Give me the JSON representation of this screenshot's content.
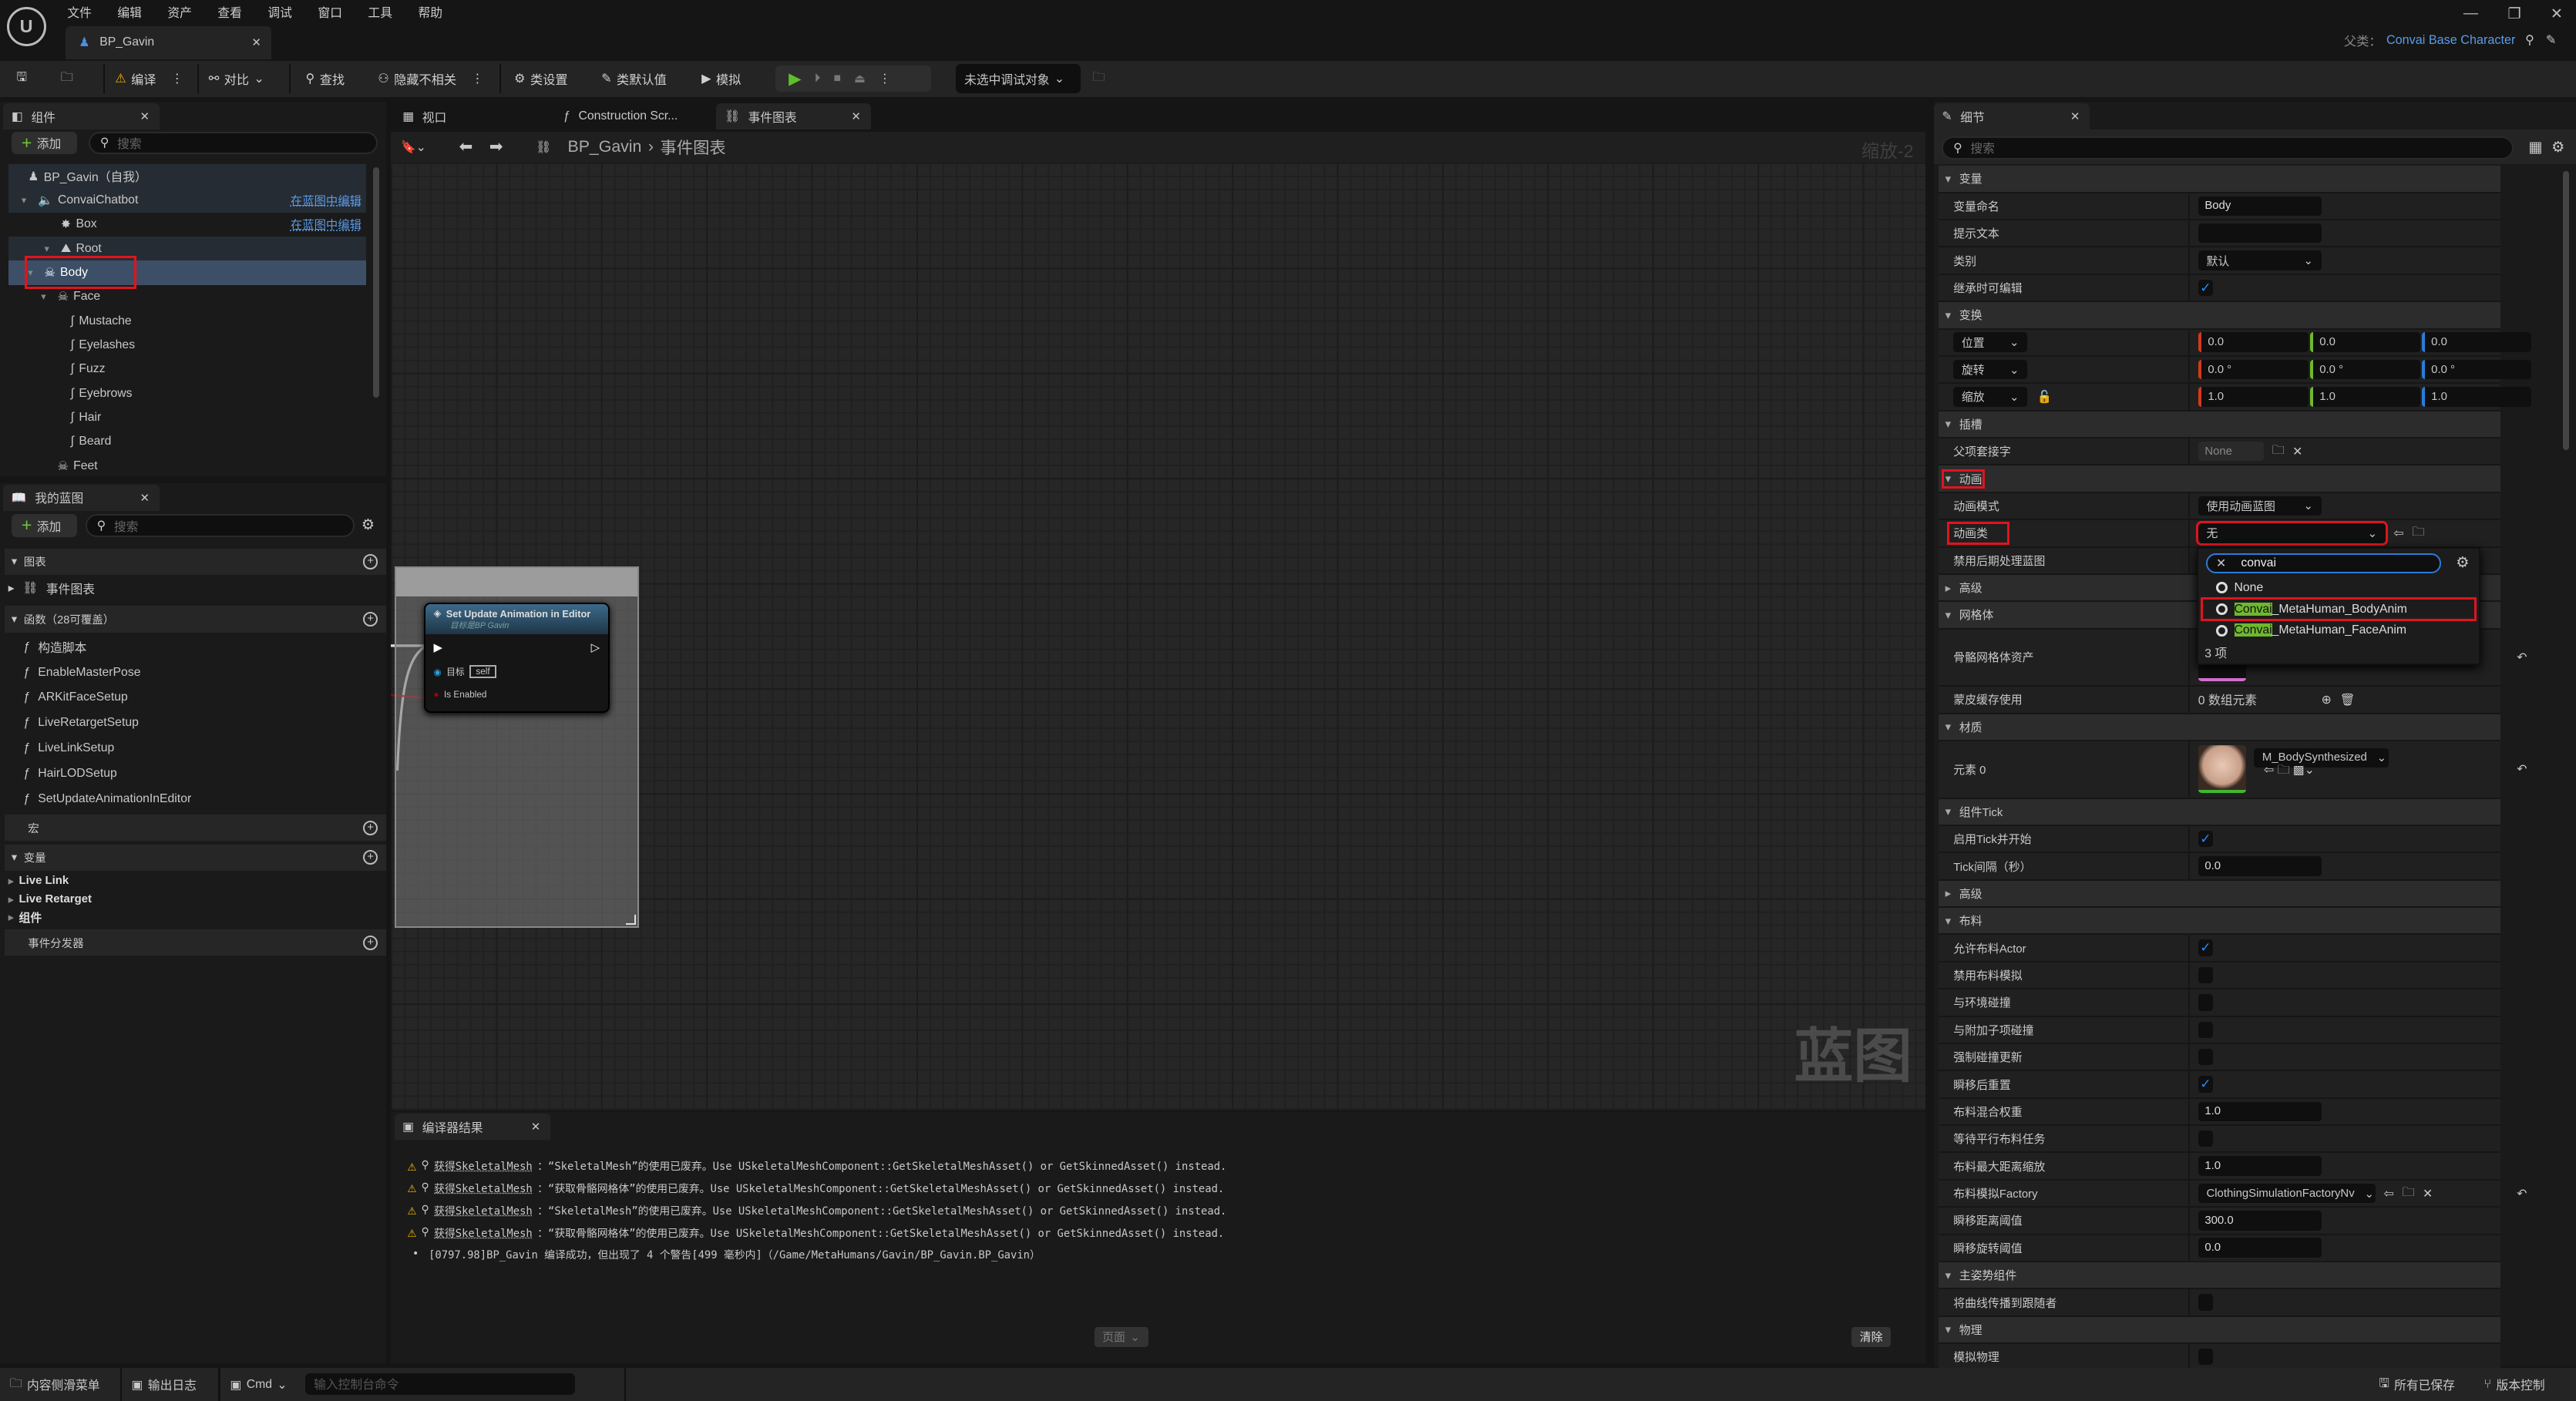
{
  "app": {
    "menu": [
      "文件",
      "编辑",
      "资产",
      "查看",
      "调试",
      "窗口",
      "工具",
      "帮助"
    ],
    "doc_tab": "BP_Gavin",
    "parent_class_label": "父类：",
    "parent_class": "Convai Base Character"
  },
  "toolbar": {
    "compile": "编译",
    "diff": "对比",
    "find": "查找",
    "hide_unrelated": "隐藏不相关",
    "class_settings": "类设置",
    "class_defaults": "类默认值",
    "simulate": "模拟",
    "debug_object": "未选中调试对象"
  },
  "components": {
    "tab": "组件",
    "add": "添加",
    "search_placeholder": "搜索",
    "edit_in_blueprint": "在蓝图中编辑",
    "tree": [
      {
        "label": "BP_Gavin（自我）",
        "icon": "pawn-icon",
        "indent": 0,
        "arrow": false,
        "style": "hl"
      },
      {
        "label": "ConvaiChatbot",
        "icon": "speaker-icon",
        "indent": 1,
        "arrow": true,
        "style": "hl",
        "link": true
      },
      {
        "label": "Box",
        "icon": "collision-icon",
        "indent": 2,
        "arrow": false,
        "style": "",
        "link": true
      },
      {
        "label": "Root",
        "icon": "scene-icon",
        "indent": 2,
        "arrow": true,
        "style": "hl"
      },
      {
        "label": "Body",
        "icon": "skeleton-icon",
        "indent": 3,
        "arrow": true,
        "style": "sel",
        "highlighted": true
      },
      {
        "label": "Face",
        "icon": "skeleton-icon",
        "indent": 4,
        "arrow": true,
        "style": ""
      },
      {
        "label": "Mustache",
        "icon": "groom-icon",
        "indent": 5,
        "arrow": false,
        "style": ""
      },
      {
        "label": "Eyelashes",
        "icon": "groom-icon",
        "indent": 5,
        "arrow": false,
        "style": ""
      },
      {
        "label": "Fuzz",
        "icon": "groom-icon",
        "indent": 5,
        "arrow": false,
        "style": ""
      },
      {
        "label": "Eyebrows",
        "icon": "groom-icon",
        "indent": 5,
        "arrow": false,
        "style": ""
      },
      {
        "label": "Hair",
        "icon": "groom-icon",
        "indent": 5,
        "arrow": false,
        "style": ""
      },
      {
        "label": "Beard",
        "icon": "groom-icon",
        "indent": 5,
        "arrow": false,
        "style": ""
      },
      {
        "label": "Feet",
        "icon": "skeleton-icon",
        "indent": 4,
        "arrow": false,
        "style": ""
      }
    ]
  },
  "my_blueprint": {
    "tab": "我的蓝图",
    "add": "添加",
    "search_placeholder": "搜索",
    "graphs_header": "图表",
    "event_graph": "事件图表",
    "functions_header": "函数（28可覆盖）",
    "functions": [
      "构造脚本",
      "EnableMasterPose",
      "ARKitFaceSetup",
      "LiveRetargetSetup",
      "LiveLinkSetup",
      "HairLODSetup",
      "SetUpdateAnimationInEditor"
    ],
    "macros_header": "宏",
    "variables_header": "变量",
    "variables": [
      "Live Link",
      "Live Retarget",
      "组件"
    ],
    "dispatchers_header": "事件分发器"
  },
  "center": {
    "tabs": [
      {
        "label": "视口",
        "icon": "viewport-icon"
      },
      {
        "label": "Construction Scr...",
        "icon": "function-icon"
      },
      {
        "label": "事件图表",
        "icon": "graph-icon",
        "active": true
      }
    ],
    "breadcrumb_root": "BP_Gavin",
    "breadcrumb_current": "事件图表",
    "zoom": "缩放-2",
    "watermark": "蓝图",
    "node": {
      "title": "Set Update Animation in Editor",
      "subtitle": "目标是BP Gavin",
      "target_label": "目标",
      "target_value": "self",
      "enabled_label": "Is Enabled"
    }
  },
  "compiler": {
    "tab": "编译器结果",
    "messages": [
      {
        "type": "warning",
        "link": "获得SkeletalMesh",
        "text": "：“SkeletalMesh”的使用已废弃。Use USkeletalMeshComponent::GetSkeletalMeshAsset() or GetSkinnedAsset() instead."
      },
      {
        "type": "warning",
        "link": "获得SkeletalMesh",
        "text": "：“获取骨骼网格体”的使用已废弃。Use USkeletalMeshComponent::GetSkeletalMeshAsset() or GetSkinnedAsset() instead."
      },
      {
        "type": "warning",
        "link": "获得SkeletalMesh",
        "text": "：“SkeletalMesh”的使用已废弃。Use USkeletalMeshComponent::GetSkeletalMeshAsset() or GetSkinnedAsset() instead."
      },
      {
        "type": "warning",
        "link": "获得SkeletalMesh",
        "text": "：“获取骨骼网格体”的使用已废弃。Use USkeletalMeshComponent::GetSkeletalMeshAsset() or GetSkinnedAsset() instead."
      },
      {
        "type": "info",
        "link": "",
        "text": "[0797.98]BP_Gavin 编译成功，但出现了 4 个警告[499 毫秒内]（/Game/MetaHumans/Gavin/BP_Gavin.BP_Gavin）"
      }
    ],
    "page_button": "页面",
    "clear_button": "清除"
  },
  "details": {
    "tab": "细节",
    "search_placeholder": "搜索",
    "rows": [
      {
        "h": "变量"
      },
      {
        "l": "变量命名",
        "k": "text",
        "v": "Body"
      },
      {
        "l": "提示文本",
        "k": "text",
        "v": ""
      },
      {
        "l": "类别",
        "k": "combo",
        "v": "默认"
      },
      {
        "l": "继承时可编辑",
        "k": "check",
        "v": true
      },
      {
        "h": "变换"
      },
      {
        "l": "位置",
        "k": "vec",
        "v": [
          "0.0",
          "0.0",
          "0.0"
        ]
      },
      {
        "l": "旋转",
        "k": "vec",
        "v": [
          "0.0 °",
          "0.0 °",
          "0.0 °"
        ]
      },
      {
        "l": "缩放",
        "k": "vec",
        "v": [
          "1.0",
          "1.0",
          "1.0"
        ],
        "lock": true
      },
      {
        "h": "插槽"
      },
      {
        "l": "父项套接字",
        "k": "socket",
        "v": "None"
      },
      {
        "h": "动画",
        "highlighted": true
      },
      {
        "l": "动画模式",
        "k": "drop",
        "v": "使用动画蓝图"
      },
      {
        "l": "动画类",
        "k": "animclass",
        "v": "无",
        "highlighted": true
      },
      {
        "l": "禁用后期处理蓝图",
        "k": "check",
        "v": false
      },
      {
        "h": "高级",
        "closed": true
      },
      {
        "h": "网格体"
      },
      {
        "l": "骨骼网格体资产",
        "k": "asset",
        "tall": true
      },
      {
        "l": "蒙皮缓存使用",
        "k": "array",
        "v": "0 数组元素"
      },
      {
        "h": "材质"
      },
      {
        "l": "元素 0",
        "k": "material",
        "v": "M_BodySynthesized",
        "tall": true
      },
      {
        "h": "组件Tick"
      },
      {
        "l": "启用Tick并开始",
        "k": "check",
        "v": true
      },
      {
        "l": "Tick间隔（秒）",
        "k": "text",
        "v": "0.0"
      },
      {
        "h": "高级",
        "closed": true
      },
      {
        "h": "布料"
      },
      {
        "l": "允许布料Actor",
        "k": "check",
        "v": true
      },
      {
        "l": "禁用布料模拟",
        "k": "check",
        "v": false
      },
      {
        "l": "与环境碰撞",
        "k": "check",
        "v": false
      },
      {
        "l": "与附加子项碰撞",
        "k": "check",
        "v": false
      },
      {
        "l": "强制碰撞更新",
        "k": "check",
        "v": false
      },
      {
        "l": "瞬移后重置",
        "k": "check",
        "v": true
      },
      {
        "l": "布料混合权重",
        "k": "text",
        "v": "1.0"
      },
      {
        "l": "等待平行布料任务",
        "k": "check",
        "v": false
      },
      {
        "l": "布料最大距离缩放",
        "k": "text",
        "v": "1.0"
      },
      {
        "l": "布料模拟Factory",
        "k": "factory",
        "v": "ClothingSimulationFactoryNv"
      },
      {
        "l": "瞬移距离阈值",
        "k": "text",
        "v": "300.0"
      },
      {
        "l": "瞬移旋转阈值",
        "k": "text",
        "v": "0.0"
      },
      {
        "h": "主姿势组件"
      },
      {
        "l": "将曲线传播到跟随者",
        "k": "check",
        "v": false
      },
      {
        "h": "物理"
      },
      {
        "l": "模拟物理",
        "k": "check",
        "v": false
      }
    ]
  },
  "anim_picker": {
    "search_value": "convai",
    "items": [
      {
        "match": "",
        "rest": "None"
      },
      {
        "match": "Convai",
        "rest": "_MetaHuman_BodyAnim",
        "highlighted": true
      },
      {
        "match": "Convai",
        "rest": "_MetaHuman_FaceAnim"
      }
    ],
    "count": "3 项"
  },
  "statusbar": {
    "content_drawer": "内容侧滑菜单",
    "output_log": "输出日志",
    "cmd": "Cmd",
    "console_placeholder": "输入控制台命令",
    "all_saved": "所有已保存",
    "source_control": "版本控制"
  },
  "colors": {
    "accent_blue": "#5b9be6",
    "highlight_red": "#e0141e",
    "match_green": "#6fb82e",
    "play_green": "#5fbf2a",
    "axis_x": "#d33a1f",
    "axis_y": "#6fb82e",
    "axis_z": "#2b7cd8"
  }
}
